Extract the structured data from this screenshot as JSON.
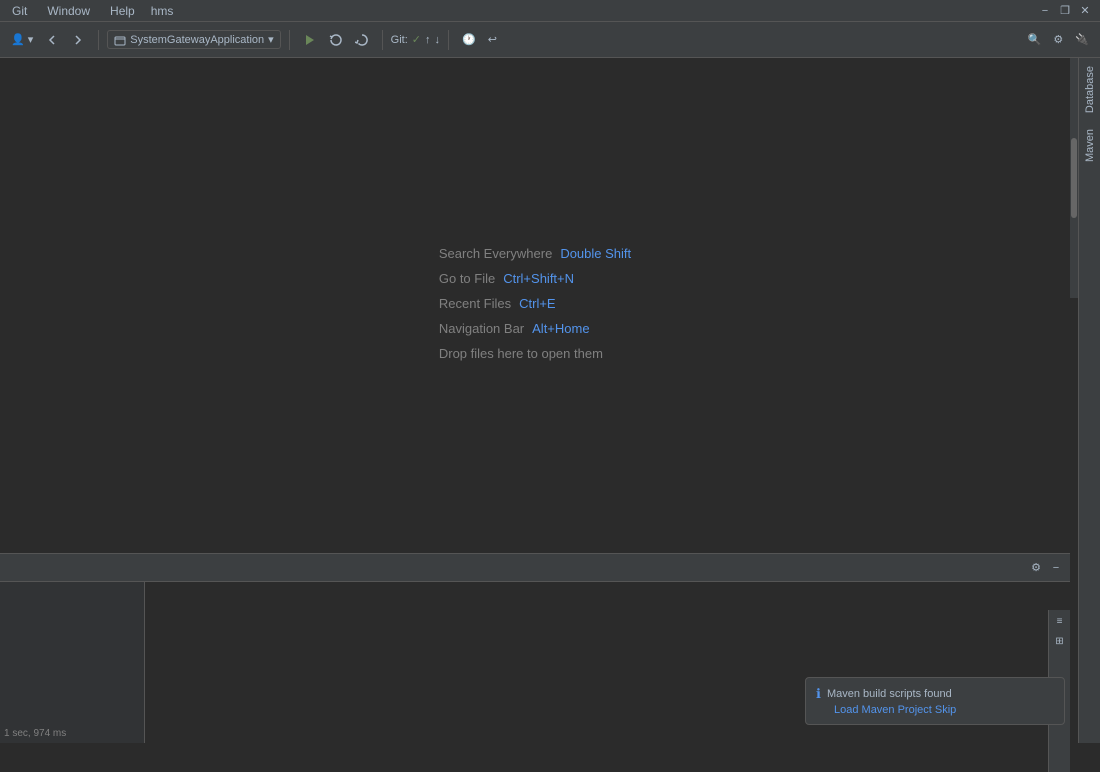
{
  "titlebar": {
    "title": "hms",
    "menu_items": [
      "Git",
      "Window",
      "Help"
    ]
  },
  "window_controls": {
    "minimize": "−",
    "restore": "❐",
    "close": "✕"
  },
  "toolbar": {
    "user_icon": "👤",
    "nav_back": "←",
    "nav_forward": "→",
    "project_label": "SystemGatewayApplication",
    "run_icon": "▶",
    "reload_icon": "↺",
    "rerun_icon": "↻",
    "git_label": "Git:",
    "git_check": "✓",
    "git_arrow_up": "↑",
    "git_arrow_down": "↓",
    "history_icon": "🕐",
    "undo_icon": "↩",
    "search_icon": "🔍",
    "settings_icon": "⚙",
    "plugin_icon": "🔌"
  },
  "right_sidebar": {
    "tabs": [
      "Database",
      "Maven"
    ]
  },
  "hints": {
    "search_everywhere_label": "Search Everywhere",
    "search_everywhere_shortcut": "Double Shift",
    "goto_file_label": "Go to File",
    "goto_file_shortcut": "Ctrl+Shift+N",
    "recent_files_label": "Recent Files",
    "recent_files_shortcut": "Ctrl+E",
    "navigation_bar_label": "Navigation Bar",
    "navigation_bar_shortcut": "Alt+Home",
    "drop_files_label": "Drop files here to open them"
  },
  "bottom_panel": {
    "time": "1 sec, 974 ms",
    "settings_icon": "⚙",
    "minimize_icon": "−"
  },
  "maven_notification": {
    "icon": "ℹ",
    "title": "Maven build scripts found",
    "link": "Load Maven Project    Skip"
  }
}
